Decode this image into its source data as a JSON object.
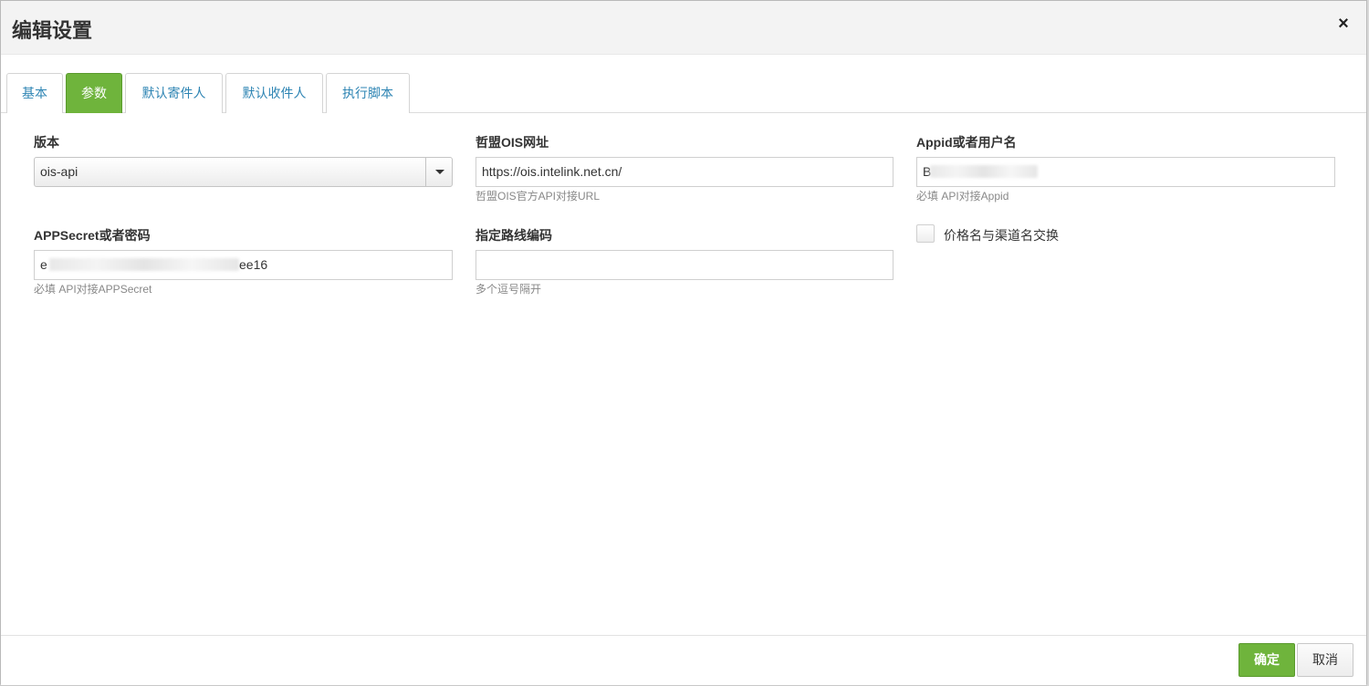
{
  "dialog": {
    "title": "编辑设置",
    "close_icon": "×"
  },
  "tabs": [
    {
      "label": "基本",
      "active": false
    },
    {
      "label": "参数",
      "active": true
    },
    {
      "label": "默认寄件人",
      "active": false
    },
    {
      "label": "默认收件人",
      "active": false
    },
    {
      "label": "执行脚本",
      "active": false
    }
  ],
  "form": {
    "version": {
      "label": "版本",
      "value": "ois-api"
    },
    "url": {
      "label": "哲盟OIS网址",
      "value": "https://ois.intelink.net.cn/",
      "help": "哲盟OIS官方API对接URL"
    },
    "appid": {
      "label": "Appid或者用户名",
      "value": "B",
      "help": "必填 API对接Appid"
    },
    "secret": {
      "label": "APPSecret或者密码",
      "value_prefix": "e",
      "value_suffix": "ee16",
      "help": "必填 API对接APPSecret"
    },
    "route": {
      "label": "指定路线编码",
      "value": "",
      "help": "多个逗号隔开"
    },
    "swap": {
      "label": "价格名与渠道名交换",
      "checked": false
    }
  },
  "footer": {
    "ok_label": "确定",
    "cancel_label": "取消"
  },
  "colors": {
    "accent_green": "#6fb43c",
    "tab_link": "#2d84b3"
  }
}
